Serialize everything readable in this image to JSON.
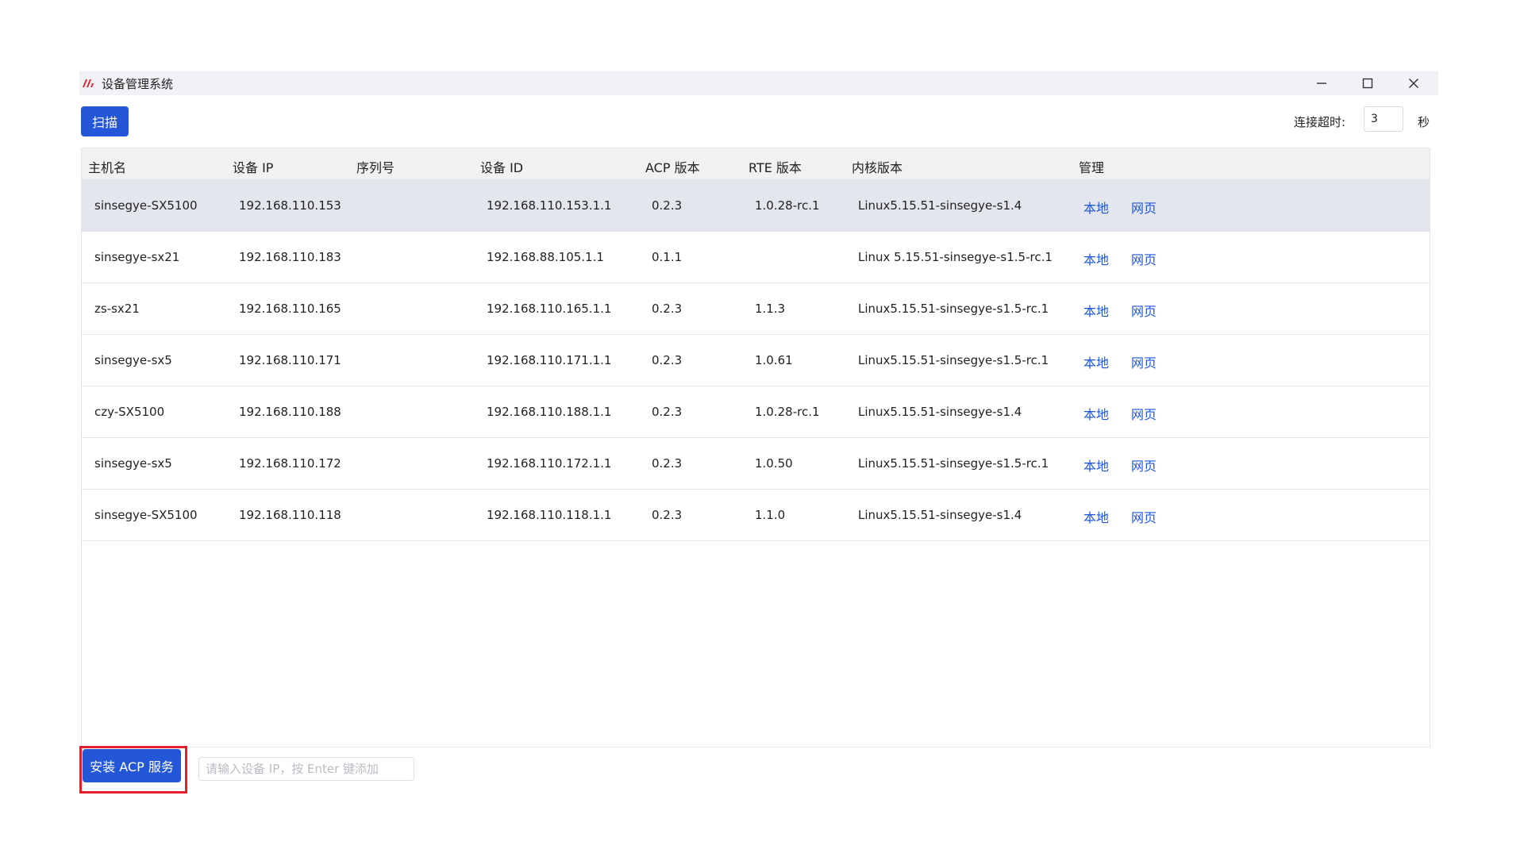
{
  "window": {
    "title": "设备管理系统",
    "logo_icon": "app-logo-icon",
    "controls": [
      "minimize-icon",
      "maximize-icon",
      "close-icon"
    ]
  },
  "toolbar": {
    "scan_label": "扫描",
    "timeout_label": "连接超时:",
    "timeout_value": "3",
    "timeout_unit": "秒"
  },
  "table": {
    "columns": [
      "主机名",
      "设备 IP",
      "序列号",
      "设备 ID",
      "ACP 版本",
      "RTE 版本",
      "内核版本",
      "管理"
    ],
    "rows": [
      {
        "host": "sinsegye-SX5100",
        "ip": "192.168.110.153",
        "serial": "",
        "device_id": "192.168.110.153.1.1",
        "acp": "0.2.3",
        "rte": "1.0.28-rc.1",
        "kernel": "Linux5.15.51-sinsegye-s1.4",
        "local": "本地",
        "web": "网页"
      },
      {
        "host": "sinsegye-sx21",
        "ip": "192.168.110.183",
        "serial": "",
        "device_id": "192.168.88.105.1.1",
        "acp": "0.1.1",
        "rte": "",
        "kernel": "Linux 5.15.51-sinsegye-s1.5-rc.1",
        "local": "本地",
        "web": "网页"
      },
      {
        "host": "zs-sx21",
        "ip": "192.168.110.165",
        "serial": "",
        "device_id": "192.168.110.165.1.1",
        "acp": "0.2.3",
        "rte": "1.1.3",
        "kernel": "Linux5.15.51-sinsegye-s1.5-rc.1",
        "local": "本地",
        "web": "网页"
      },
      {
        "host": "sinsegye-sx5",
        "ip": "192.168.110.171",
        "serial": "",
        "device_id": "192.168.110.171.1.1",
        "acp": "0.2.3",
        "rte": "1.0.61",
        "kernel": "Linux5.15.51-sinsegye-s1.5-rc.1",
        "local": "本地",
        "web": "网页"
      },
      {
        "host": "czy-SX5100",
        "ip": "192.168.110.188",
        "serial": "",
        "device_id": "192.168.110.188.1.1",
        "acp": "0.2.3",
        "rte": "1.0.28-rc.1",
        "kernel": "Linux5.15.51-sinsegye-s1.4",
        "local": "本地",
        "web": "网页"
      },
      {
        "host": "sinsegye-sx5",
        "ip": "192.168.110.172",
        "serial": "",
        "device_id": "192.168.110.172.1.1",
        "acp": "0.2.3",
        "rte": "1.0.50",
        "kernel": "Linux5.15.51-sinsegye-s1.5-rc.1",
        "local": "本地",
        "web": "网页"
      },
      {
        "host": "sinsegye-SX5100",
        "ip": "192.168.110.118",
        "serial": "",
        "device_id": "192.168.110.118.1.1",
        "acp": "0.2.3",
        "rte": "1.1.0",
        "kernel": "Linux5.15.51-sinsegye-s1.4",
        "local": "本地",
        "web": "网页"
      }
    ],
    "selected_row": 0
  },
  "footer": {
    "install_label": "安装 ACP 服务",
    "ip_input_value": "",
    "ip_input_placeholder": "请输入设备 IP，按 Enter 键添加"
  },
  "colors": {
    "primary": "#2457d8",
    "link": "#1f56d8",
    "highlight": "#e3202a",
    "selected_row": "#e3e6ec"
  }
}
